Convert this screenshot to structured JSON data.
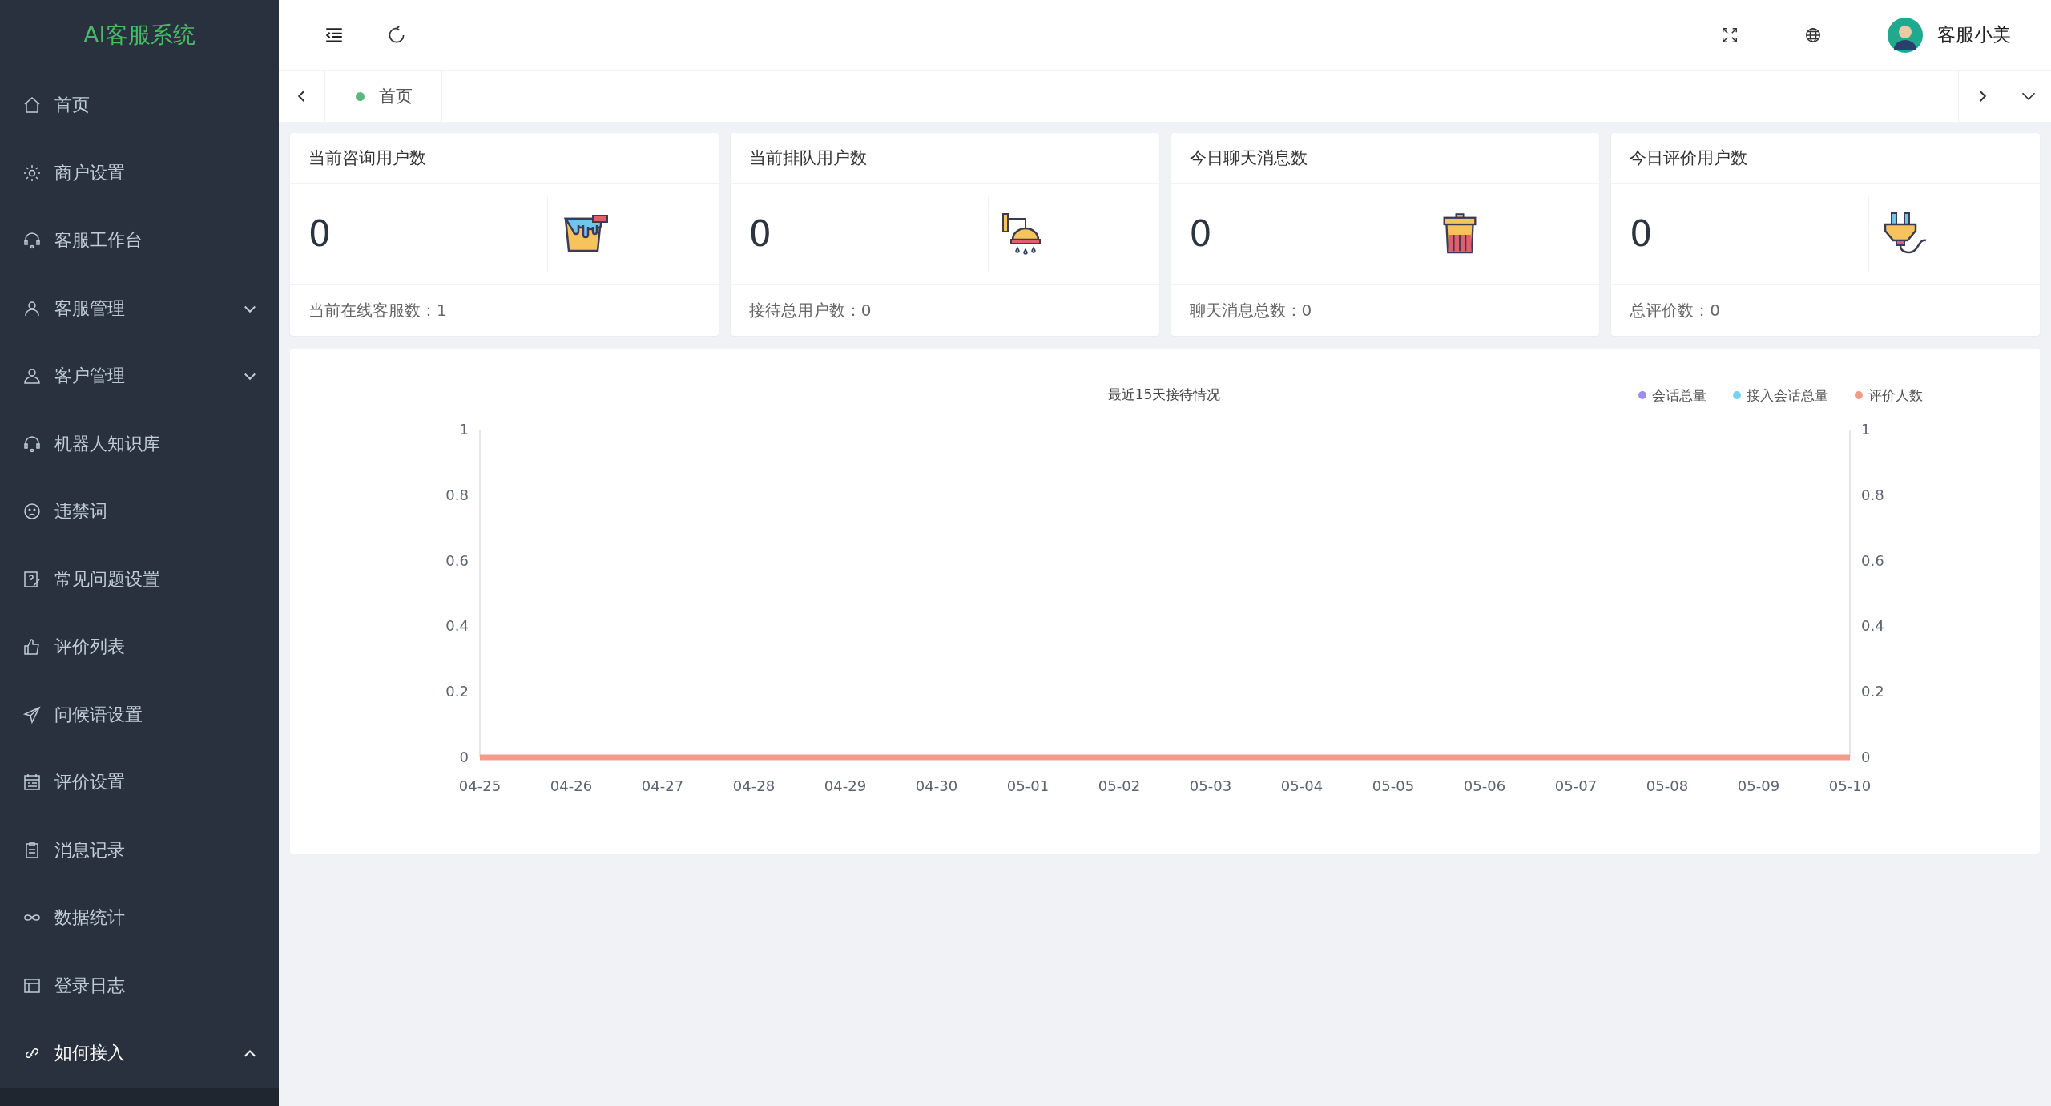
{
  "sidebar": {
    "logo": "AI客服系统",
    "items": [
      {
        "label": "首页",
        "kind": "link"
      },
      {
        "label": "商户设置",
        "kind": "link"
      },
      {
        "label": "客服工作台",
        "kind": "link"
      },
      {
        "label": "客服管理",
        "kind": "submenu",
        "expanded": false
      },
      {
        "label": "客户管理",
        "kind": "submenu",
        "expanded": false
      },
      {
        "label": "机器人知识库",
        "kind": "link"
      },
      {
        "label": "违禁词",
        "kind": "link"
      },
      {
        "label": "常见问题设置",
        "kind": "link"
      },
      {
        "label": "评价列表",
        "kind": "link"
      },
      {
        "label": "问候语设置",
        "kind": "link"
      },
      {
        "label": "评价设置",
        "kind": "link"
      },
      {
        "label": "消息记录",
        "kind": "link"
      },
      {
        "label": "数据统计",
        "kind": "link"
      },
      {
        "label": "登录日志",
        "kind": "link"
      },
      {
        "label": "如何接入",
        "kind": "submenu",
        "expanded": true
      }
    ]
  },
  "header": {
    "user": {
      "name": "客服小美"
    }
  },
  "tabs": [
    {
      "label": "首页",
      "selected": true
    }
  ],
  "stat_cards": [
    {
      "title": "当前咨询用户数",
      "value": "0",
      "footer": "当前在线客服数：1"
    },
    {
      "title": "当前排队用户数",
      "value": "0",
      "footer": "接待总用户数：0"
    },
    {
      "title": "今日聊天消息数",
      "value": "0",
      "footer": "聊天消息总数：0"
    },
    {
      "title": "今日评价用户数",
      "value": "0",
      "footer": "总评价数：0"
    }
  ],
  "chart_card": {
    "chart_data": {
      "type": "line",
      "title": "最近15天接待情况",
      "categories": [
        "04-25",
        "04-26",
        "04-27",
        "04-28",
        "04-29",
        "04-30",
        "05-01",
        "05-02",
        "05-03",
        "05-04",
        "05-05",
        "05-06",
        "05-07",
        "05-08",
        "05-09",
        "05-10"
      ],
      "series": [
        {
          "name": "会话总量",
          "color": "#9d8df1",
          "values": [
            null,
            null,
            null,
            null,
            null,
            null,
            null,
            null,
            null,
            null,
            null,
            null,
            null,
            null,
            null,
            null
          ]
        },
        {
          "name": "接入会话总量",
          "color": "#73d3f0",
          "values": [
            null,
            null,
            null,
            null,
            null,
            null,
            null,
            null,
            null,
            null,
            null,
            null,
            null,
            null,
            null,
            null
          ]
        },
        {
          "name": "评价人数",
          "color": "#f29b89",
          "values": [
            0,
            0,
            0,
            0,
            0,
            0,
            0,
            0,
            0,
            0,
            0,
            0,
            0,
            0,
            0,
            0
          ]
        }
      ],
      "ylim": [
        0,
        1
      ],
      "yticks": [
        0,
        0.2,
        0.4,
        0.6,
        0.8,
        1
      ],
      "y2lim": [
        0,
        1
      ],
      "y2ticks": [
        0,
        0.2,
        0.4,
        0.6,
        0.8,
        1
      ],
      "legend": true
    }
  }
}
